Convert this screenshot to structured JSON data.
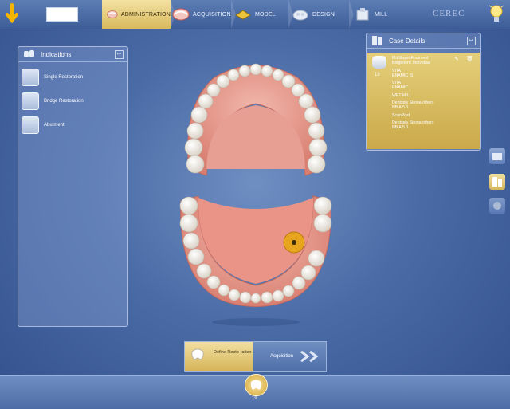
{
  "topbar": {
    "back_icon": "back-arrow-icon",
    "patient_box": "",
    "steps": [
      {
        "label": "ADMINISTRATION",
        "icon": "teeth-icon",
        "active": true
      },
      {
        "label": "ACQUISITION",
        "icon": "teeth-scan-icon",
        "active": false
      },
      {
        "label": "MODEL",
        "icon": "model-icon",
        "active": false
      },
      {
        "label": "DESIGN",
        "icon": "design-icon",
        "active": false
      },
      {
        "label": "MILL",
        "icon": "mill-icon",
        "active": false
      }
    ],
    "brand": "CEREC",
    "help_icon": "lightbulb-icon"
  },
  "indications": {
    "title": "Indications",
    "items": [
      {
        "label": "Single Restoration",
        "icon": "single-restoration-icon"
      },
      {
        "label": "Bridge Restoration",
        "icon": "bridge-restoration-icon"
      },
      {
        "label": "Abutment",
        "icon": "abutment-icon"
      }
    ]
  },
  "case_details": {
    "title": "Case Details",
    "tooth_number": "19",
    "lines": [
      "Multilayer Abutment",
      "Biogeneric Individual",
      "",
      "VITA",
      "ENAMIC IS",
      "",
      "VITA",
      "ENAMIC",
      "",
      "WET MILL",
      "",
      "Dentsply Sirona others",
      "NB A 5.0",
      "",
      "ScanPost",
      "",
      "Dentsply Sirona others",
      "NB A 5.0"
    ]
  },
  "wizard": {
    "current_label": "Define Resto-ration",
    "next_label": "Acquisition"
  },
  "tooth_bar": {
    "selected_number": "19"
  },
  "colors": {
    "accent_gold": "#d9b95c",
    "bg_blue": "#4a6ba6",
    "selected_tooth": "#e8a520"
  }
}
